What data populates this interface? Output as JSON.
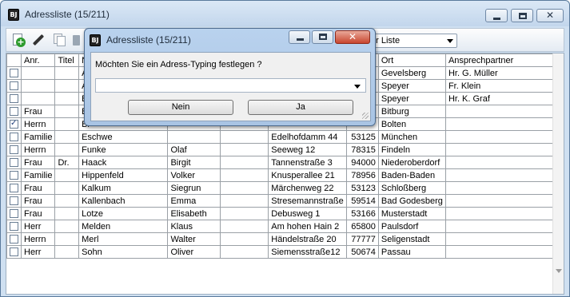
{
  "window": {
    "title": "Adressliste (15/211)",
    "app_icon_text": "BJ"
  },
  "toolbar": {
    "list_select_value": "er Liste"
  },
  "grid": {
    "columns": [
      "",
      "Anr.",
      "Titel",
      "Na",
      "",
      "",
      "",
      "Ort",
      "Ansprechpartner"
    ],
    "rows": [
      {
        "checked": false,
        "anr": "",
        "titel": "",
        "name": "Al",
        "vorname": "",
        "extra": "",
        "strasse": "",
        "plz": "",
        "ort": "Gevelsberg",
        "ansprech": "Hr. G. Müller"
      },
      {
        "checked": false,
        "anr": "",
        "titel": "",
        "name": "Al",
        "vorname": "",
        "extra": "",
        "strasse": "",
        "plz": "",
        "ort": "Speyer",
        "ansprech": "Fr. Klein"
      },
      {
        "checked": false,
        "anr": "",
        "titel": "",
        "name": "B.",
        "vorname": "",
        "extra": "",
        "strasse": "",
        "plz": "",
        "ort": "Speyer",
        "ansprech": "Hr. K. Graf"
      },
      {
        "checked": false,
        "anr": "Frau",
        "titel": "",
        "name": "Bi",
        "vorname": "",
        "extra": "",
        "strasse": "",
        "plz": "",
        "ort": "Bitburg",
        "ansprech": ""
      },
      {
        "checked": true,
        "anr": "Herrn",
        "titel": "",
        "name": "Bi",
        "vorname": "",
        "extra": "",
        "strasse": "",
        "plz": "",
        "ort": "Bolten",
        "ansprech": ""
      },
      {
        "checked": false,
        "anr": "Familie",
        "titel": "",
        "name": "Eschwe",
        "vorname": "",
        "extra": "",
        "strasse": "Edelhofdamm 44",
        "plz": "53125",
        "ort": "München",
        "ansprech": ""
      },
      {
        "checked": false,
        "anr": "Herrn",
        "titel": "",
        "name": "Funke",
        "vorname": "Olaf",
        "extra": "",
        "strasse": "Seeweg 12",
        "plz": "78315",
        "ort": "Findeln",
        "ansprech": ""
      },
      {
        "checked": false,
        "anr": "Frau",
        "titel": "Dr.",
        "name": "Haack",
        "vorname": "Birgit",
        "extra": "",
        "strasse": "Tannenstraße 3",
        "plz": "94000",
        "ort": "Niederoberdorf",
        "ansprech": ""
      },
      {
        "checked": false,
        "anr": "Familie",
        "titel": "",
        "name": "Hippenfeld",
        "vorname": "Volker",
        "extra": "",
        "strasse": "Knusperallee 21",
        "plz": "78956",
        "ort": "Baden-Baden",
        "ansprech": ""
      },
      {
        "checked": false,
        "anr": "Frau",
        "titel": "",
        "name": "Kalkum",
        "vorname": "Siegrun",
        "extra": "",
        "strasse": "Märchenweg 22",
        "plz": "53123",
        "ort": "Schloßberg",
        "ansprech": ""
      },
      {
        "checked": false,
        "anr": "Frau",
        "titel": "",
        "name": "Kallenbach",
        "vorname": "Emma",
        "extra": "",
        "strasse": "Stresemannstraße",
        "plz": "59514",
        "ort": "Bad Godesberg",
        "ansprech": ""
      },
      {
        "checked": false,
        "anr": "Frau",
        "titel": "",
        "name": "Lotze",
        "vorname": "Elisabeth",
        "extra": "",
        "strasse": "Debusweg 1",
        "plz": "53166",
        "ort": "Musterstadt",
        "ansprech": ""
      },
      {
        "checked": false,
        "anr": "Herr",
        "titel": "",
        "name": "Melden",
        "vorname": "Klaus",
        "extra": "",
        "strasse": "Am hohen Hain 2",
        "plz": "65800",
        "ort": "Paulsdorf",
        "ansprech": ""
      },
      {
        "checked": false,
        "anr": "Herrn",
        "titel": "",
        "name": "Merl",
        "vorname": "Walter",
        "extra": "",
        "strasse": "Händelstraße 20",
        "plz": "77777",
        "ort": "Seligenstadt",
        "ansprech": ""
      },
      {
        "checked": false,
        "anr": "Herr",
        "titel": "",
        "name": "Sohn",
        "vorname": "Oliver",
        "extra": "",
        "strasse": "Siemensstraße12",
        "plz": "50674",
        "ort": "Passau",
        "ansprech": ""
      }
    ]
  },
  "dialog": {
    "title": "Adressliste (15/211)",
    "app_icon_text": "BJ",
    "question": "Möchten Sie ein Adress-Typing festlegen ?",
    "combo_value": "",
    "no_label": "Nein",
    "yes_label": "Ja"
  }
}
